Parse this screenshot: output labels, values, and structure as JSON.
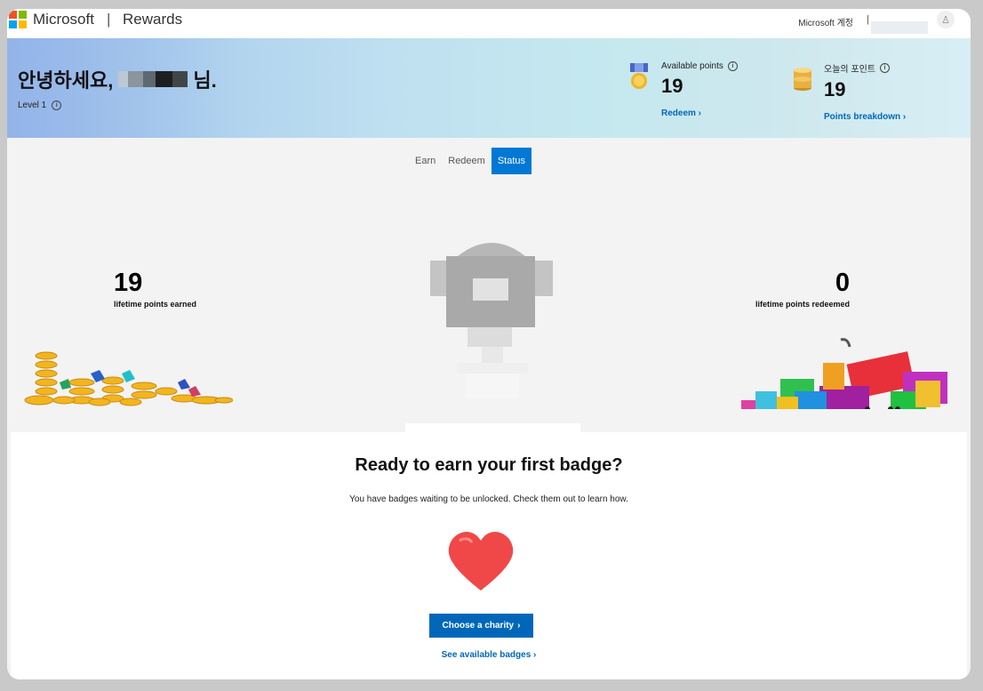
{
  "header": {
    "brand": "Microsoft",
    "divider": "|",
    "product": "Rewards",
    "account_label": "Microsoft 계정",
    "account_separator": "|",
    "logo_colors": [
      "#f25022",
      "#7fba00",
      "#00a4ef",
      "#ffb900"
    ]
  },
  "hero": {
    "greeting_prefix": "안녕하세요,",
    "greeting_suffix": "님.",
    "level": "Level 1",
    "available": {
      "label": "Available points",
      "value": "19",
      "link": "Redeem ›"
    },
    "today": {
      "label": "오늘의 포인트",
      "value": "19",
      "link": "Points breakdown ›"
    }
  },
  "tabs": [
    {
      "label": "Earn",
      "active": false
    },
    {
      "label": "Redeem",
      "active": false
    },
    {
      "label": "Status",
      "active": true
    }
  ],
  "stats": {
    "earned_value": "19",
    "earned_label": "lifetime points earned",
    "redeemed_value": "0",
    "redeemed_label": "lifetime points redeemed"
  },
  "badge_section": {
    "headline": "Ready to earn your first badge?",
    "subtitle": "You have badges waiting to be unlocked. Check them out to learn how.",
    "charity_button": "Choose a charity",
    "see_badges": "See available badges ›"
  },
  "colors": {
    "accent": "#0067b8",
    "tab_active": "#0078d4",
    "heart": "#f04848"
  }
}
